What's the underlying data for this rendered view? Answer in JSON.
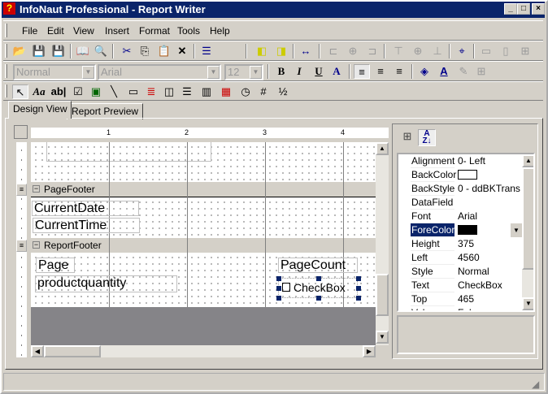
{
  "window": {
    "title": "InfoNaut Professional - Report Writer",
    "app_icon": "question-puzzle-icon",
    "controls": [
      "minimize",
      "maximize",
      "close"
    ]
  },
  "menu": [
    "File",
    "Edit",
    "View",
    "Insert",
    "Format",
    "Tools",
    "Help"
  ],
  "toolbar_standard": [
    "open-folder-icon",
    "save-icon",
    "save-as-icon",
    "book-icon",
    "print-preview-icon",
    "cut-icon",
    "copy-icon",
    "paste-icon",
    "delete-icon",
    "tab-order-icon",
    "bring-to-front-icon",
    "send-to-back-icon",
    "same-width-icon",
    "align-left-icon",
    "align-center-icon",
    "align-right-icon",
    "align-top-icon",
    "align-middle-icon",
    "align-bottom-icon",
    "center-in-section-icon",
    "space-horizontal-icon",
    "space-vertical-icon",
    "snap-grid-icon"
  ],
  "format_toolbar": {
    "style": "Normal",
    "font": "Arial",
    "size": "12",
    "bold": "B",
    "italic": "I",
    "underline": "U",
    "font_a": "A"
  },
  "toolbox": [
    "pointer-icon",
    "label-icon",
    "textbox-icon",
    "checkbox-icon",
    "picture-icon",
    "line-icon",
    "rectangle-icon",
    "rich-text-icon",
    "subreport-icon",
    "page-break-icon",
    "barcode-icon",
    "date-icon",
    "time-icon",
    "page-number-icon",
    "page-count-icon"
  ],
  "tabs": [
    {
      "label": "Design View",
      "active": true
    },
    {
      "label": "Report Preview",
      "active": false
    }
  ],
  "ruler": {
    "marks": [
      "1",
      "2",
      "3",
      "4"
    ]
  },
  "sections": {
    "page_footer": {
      "label": "PageFooter",
      "fields": [
        "CurrentDate",
        "CurrentTime"
      ]
    },
    "report_footer": {
      "label": "ReportFooter",
      "fields": [
        "Page",
        "productquantity",
        "PageCount",
        "CheckBox"
      ]
    }
  },
  "properties": {
    "rows": [
      {
        "name": "Alignment",
        "value": "0- Left"
      },
      {
        "name": "BackColor",
        "value": "",
        "swatch": "#ffffff"
      },
      {
        "name": "BackStyle",
        "value": "0 - ddBKTrans"
      },
      {
        "name": "DataField",
        "value": ""
      },
      {
        "name": "Font",
        "value": "Arial"
      },
      {
        "name": "ForeColor",
        "value": "",
        "swatch": "#000000",
        "selected": true
      },
      {
        "name": "Height",
        "value": "375"
      },
      {
        "name": "Left",
        "value": "4560"
      },
      {
        "name": "Style",
        "value": "Normal"
      },
      {
        "name": "Text",
        "value": "CheckBox"
      },
      {
        "name": "Top",
        "value": "465"
      },
      {
        "name": "Value",
        "value": "False"
      }
    ]
  },
  "colors": {
    "titlebar": "#0a246a",
    "chrome": "#d4d0c8",
    "selection": "#0a246a"
  }
}
